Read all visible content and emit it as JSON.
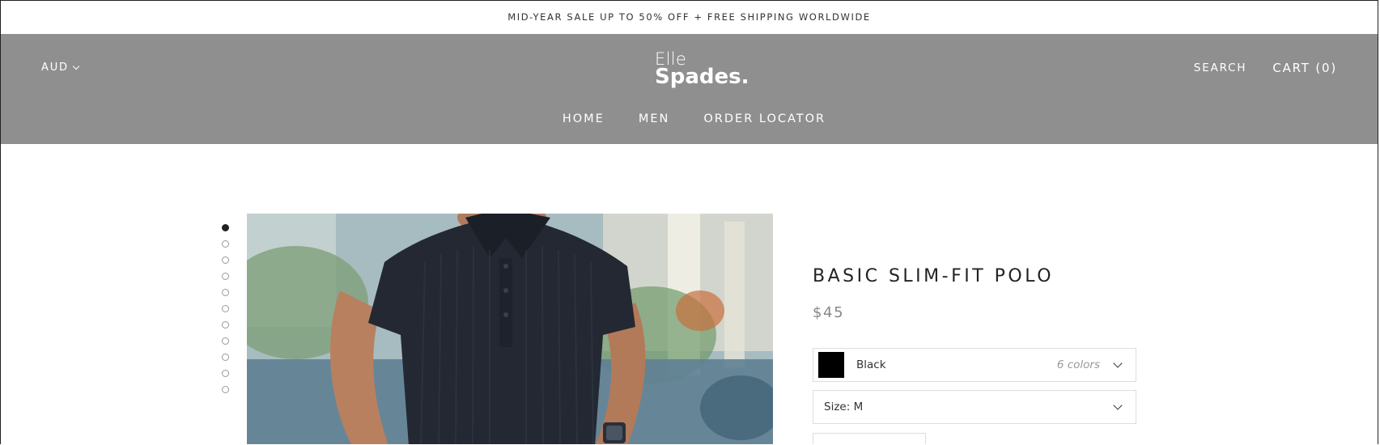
{
  "announcement": {
    "text": "MID-YEAR SALE UP TO 50% OFF + FREE SHIPPING WORLDWIDE"
  },
  "header": {
    "currency": "AUD",
    "logo": {
      "line1": "Elle",
      "line2": "Spades."
    },
    "search_label": "SEARCH",
    "cart_label": "CART (0)"
  },
  "nav": {
    "items": [
      {
        "label": "HOME"
      },
      {
        "label": "MEN"
      },
      {
        "label": "ORDER LOCATOR"
      }
    ]
  },
  "gallery": {
    "dot_count": 11,
    "active_index": 0
  },
  "product": {
    "title": "BASIC SLIM-FIT POLO",
    "price": "$45",
    "color": {
      "selected": "Black",
      "count_label": "6 colors",
      "swatch": "#000000"
    },
    "size": {
      "label": "Size:",
      "selected": "M"
    }
  },
  "colors": {
    "header_bg": "#8f8f8f",
    "accent_dark": "#222222"
  }
}
